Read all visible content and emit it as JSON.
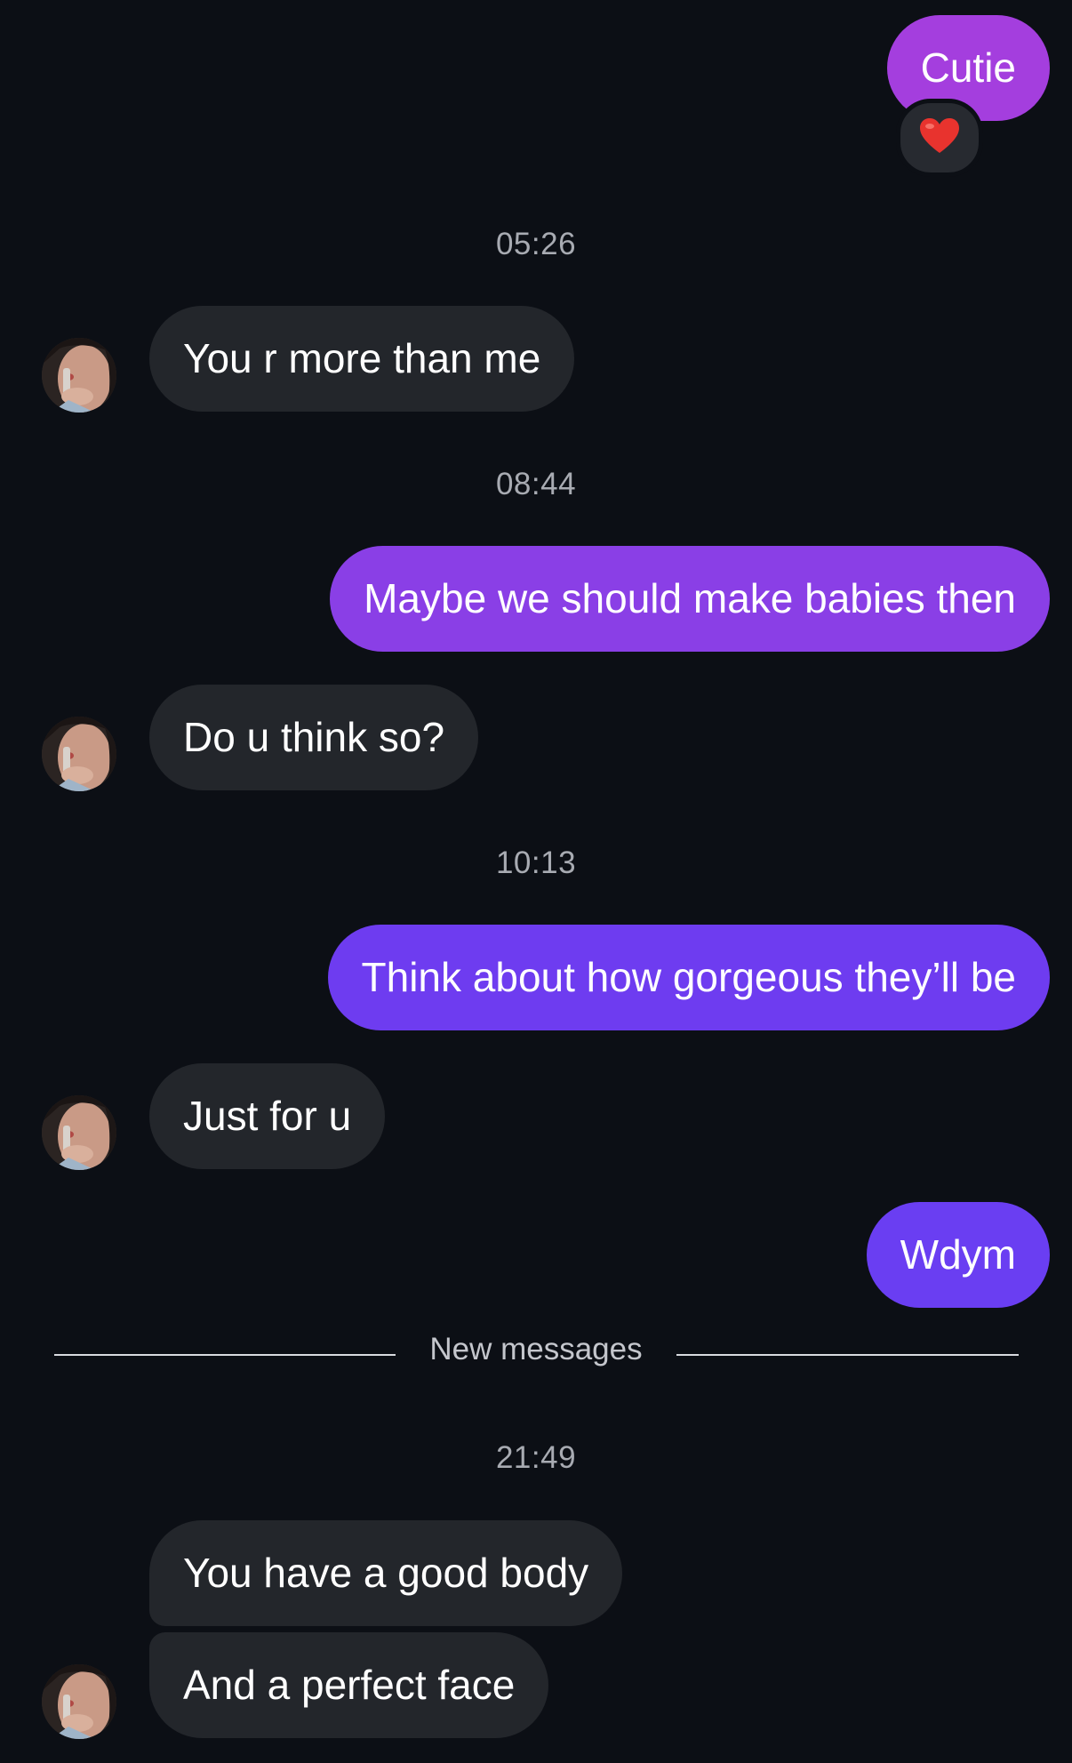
{
  "colors": {
    "background": "#0c0f15",
    "incoming_bubble": "#23262b",
    "outgoing_gradient_top": "#a53ddd",
    "outgoing_gradient_bottom": "#6a3ef2",
    "timestamp_text": "#a8abb2"
  },
  "messages": [
    {
      "type": "outgoing",
      "text": "Cutie",
      "reaction": "heart-emoji"
    },
    {
      "type": "timestamp",
      "text": "05:26"
    },
    {
      "type": "incoming",
      "text": "You r more than me",
      "avatar": "contact-avatar"
    },
    {
      "type": "timestamp",
      "text": "08:44"
    },
    {
      "type": "outgoing",
      "text": "Maybe we should make babies then"
    },
    {
      "type": "incoming",
      "text": "Do u think so?",
      "avatar": "contact-avatar"
    },
    {
      "type": "timestamp",
      "text": "10:13"
    },
    {
      "type": "outgoing",
      "text": "Think about how gorgeous they’ll be"
    },
    {
      "type": "incoming",
      "text": "Just for u",
      "avatar": "contact-avatar"
    },
    {
      "type": "outgoing",
      "text": "Wdym"
    }
  ],
  "divider": {
    "label": "New messages"
  },
  "new_messages": [
    {
      "type": "timestamp",
      "text": "21:49"
    },
    {
      "type": "incoming",
      "text": "You have a good body"
    },
    {
      "type": "incoming",
      "text": "And a perfect face",
      "avatar": "contact-avatar"
    }
  ]
}
